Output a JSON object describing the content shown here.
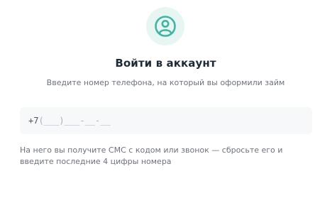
{
  "header": {
    "avatar_icon": "user-circle-icon",
    "accent_color": "#3fb5a3",
    "title": "Войти в аккаунт",
    "subtitle": "Введите номер телефона, на который вы оформили займ"
  },
  "phone_input": {
    "prefix": "+7",
    "mask": "(___)___-__-__"
  },
  "hint": {
    "line1": "На него вы получите СМС с кодом или звонок — сбросьте его и",
    "line2": "введите последние 4 цифры номера"
  }
}
